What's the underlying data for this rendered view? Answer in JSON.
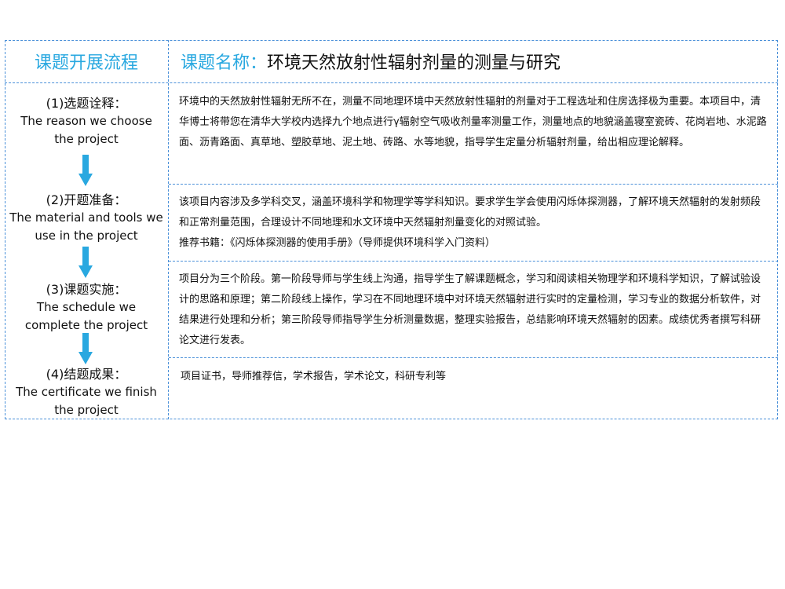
{
  "header": {
    "left_title": "课题开展流程",
    "right_label": "课题名称：",
    "right_title": "环境天然放射性辐射剂量的测量与研究"
  },
  "steps": [
    {
      "zh": "(1)选题诠释：",
      "en_line1": "The reason we choose",
      "en_line2": "the project"
    },
    {
      "zh": "(2)开题准备：",
      "en_line1": "The material and tools we",
      "en_line2": "use in the project"
    },
    {
      "zh": "(3)课题实施：",
      "en_line1": "The schedule we",
      "en_line2": "complete the project"
    },
    {
      "zh": "(4)结题成果：",
      "en_line1": "The certificate we finish",
      "en_line2": "the project"
    }
  ],
  "arrow_color": "#29a8e0",
  "content": {
    "c1": "环境中的天然放射性辐射无所不在，测量不同地理环境中天然放射性辐射的剂量对于工程选址和住房选择极为重要。本项目中，清华博士将带您在清华大学校内选择九个地点进行γ辐射空气吸收剂量率测量工作，测量地点的地貌涵盖寝室瓷砖、花岗岩地、水泥路面、沥青路面、真草地、塑胶草地、泥土地、砖路、水等地貌，指导学生定量分析辐射剂量，给出相应理论解释。",
    "c2_main": "该项目内容涉及多学科交叉，涵盖环境科学和物理学等学科知识。要求学生学会使用闪烁体探测器，了解环境天然辐射的发射频段和正常剂量范围，合理设计不同地理和水文环境中天然辐射剂量变化的对照试验。",
    "c2_books": "推荐书籍：《闪烁体探测器的使用手册》（导师提供环境科学入门资料）",
    "c3": "项目分为三个阶段。第一阶段导师与学生线上沟通，指导学生了解课题概念，学习和阅读相关物理学和环境科学知识，了解试验设计的思路和原理；第二阶段线上操作，学习在不同地理环境中对环境天然辐射进行实时的定量检测，学习专业的数据分析软件，对结果进行处理和分析；第三阶段导师指导学生分析测量数据，整理实验报告，总结影响环境天然辐射的因素。成绩优秀者撰写科研论文进行发表。",
    "c4": "项目证书，导师推荐信，学术报告，学术论文，科研专利等"
  }
}
